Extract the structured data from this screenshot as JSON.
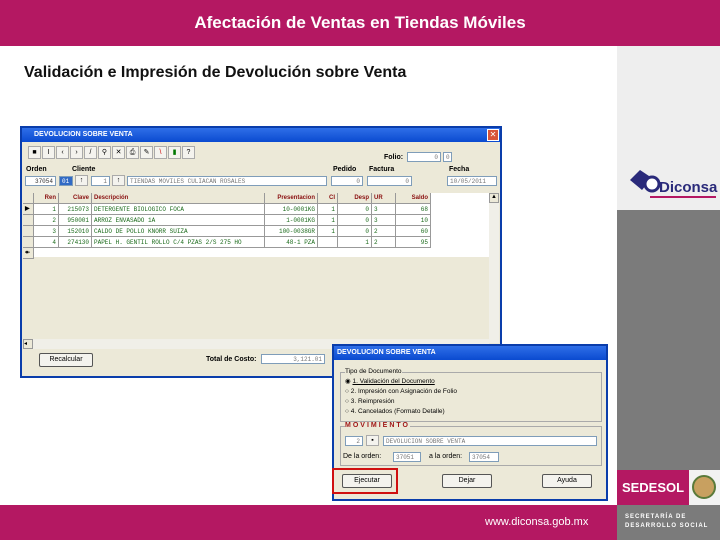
{
  "header": {
    "title": "Afectación de Ventas en Tiendas Móviles"
  },
  "subtitle": "Validación e Impresión de Devolución sobre Venta",
  "brand": {
    "logo_text": "Diconsa",
    "sedesol": "SEDESOL",
    "secretaria": "SECRETARÍA DE DESARROLLO SOCIAL",
    "url": "www.diconsa.gob.mx",
    "accent": "#b41862"
  },
  "main_window": {
    "title": "DEVOLUCION SOBRE VENTA",
    "folio_label": "Folio:",
    "folio_value": "0",
    "folio_suffix": "0",
    "orden_label": "Orden",
    "orden_value": "37054",
    "cliente_label": "Cliente",
    "cliente_code": "01",
    "cliente_num": "1",
    "cliente_name": "TIENDAS MOVILES CULIACAN ROSALES",
    "pedido_label": "Pedido",
    "pedido_value": "0",
    "factura_label": "Factura",
    "factura_value": "0",
    "fecha_label": "Fecha",
    "fecha_value": "10/05/2011",
    "columns": [
      "Ren",
      "Clave",
      "Descripción",
      "Presentacion",
      "CI",
      "Desp",
      "UR",
      "Saldo"
    ],
    "rows": [
      [
        "1",
        "215073",
        "DETERGENTE BIOLOGICO FOCA",
        "10-0001KG",
        "1",
        "0",
        "3",
        "68"
      ],
      [
        "2",
        "950001",
        "ARROZ ENVASADO 1A",
        "1-0001KG",
        "1",
        "0",
        "3",
        "10"
      ],
      [
        "3",
        "152010",
        "CALDO DE POLLO KNORR SUIZA",
        "100-0038GR",
        "1",
        "0",
        "2",
        "60"
      ],
      [
        "4",
        "274130",
        "PAPEL H. GENTIL ROLLO C/4 PZAS 2/S 275 HO",
        "48-1 PZA",
        "",
        "1",
        "2",
        "95"
      ]
    ],
    "recalc_label": "Recalcular",
    "total_label": "Total de Costo:",
    "total_value": "3,121.01"
  },
  "dialog": {
    "title": "DEVOLUCION SOBRE VENTA",
    "group_label": "Tipo de Documento",
    "options": [
      "1. Validación del Documento",
      "2. Impresión con Asignación de Folio",
      "3. Reimpresión",
      "4. Cancelados (Formato Detalle)"
    ],
    "selected": 0,
    "movimiento_label": "MOVIMIENTO",
    "mov_code": "2",
    "mov_desc": "DEVOLUCION SOBRE VENTA",
    "de_label": "De la orden:",
    "de_value": "37051",
    "a_label": "a la orden:",
    "a_value": "37054",
    "buttons": [
      "Ejecutar",
      "Dejar",
      "Ayuda"
    ]
  }
}
